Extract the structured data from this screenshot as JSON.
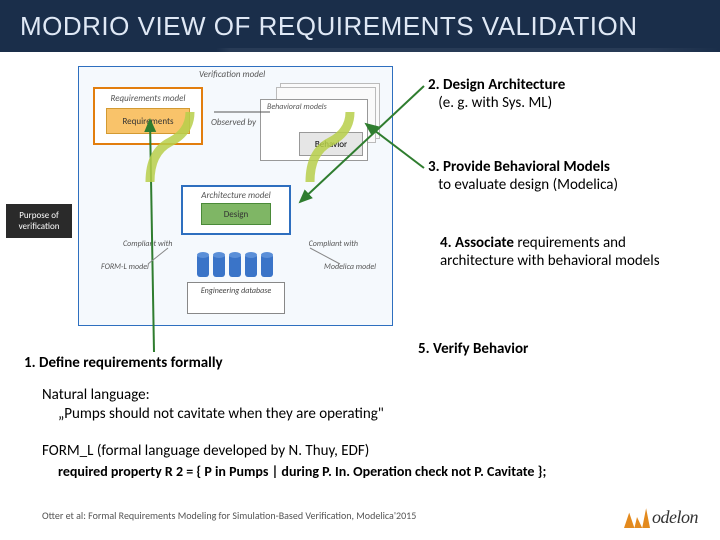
{
  "title": "MODRIO VIEW OF REQUIREMENTS VALIDATION",
  "diagram": {
    "verif_label": "Verification model",
    "req_box_label": "Requirements model",
    "req_inner": "Requirements",
    "observed_by": "Observed by",
    "beh_box_label": "Behavioral models",
    "beh_inner": "Behavior",
    "arch_box_label": "Architecture model",
    "arch_inner": "Design",
    "compliant_left": "Compliant with",
    "compliant_right": "Compliant with",
    "forml_label": "FORM-L model",
    "modelica_label": "Modelica model",
    "db_label": "Engineering database"
  },
  "purpose_badge": "Purpose of verification",
  "callouts": {
    "c1": "1. Define requirements formally",
    "c2_b": "2. Design Architecture",
    "c2_s": "(e. g. with Sys. ML)",
    "c3_b": "3. Provide Behavioral Models",
    "c3_s": "to evaluate design (Modelica)",
    "c4_b": "4. Associate",
    "c4_s": " requirements and architecture with behavioral models",
    "c5": "5. Verify Behavior"
  },
  "body": {
    "nl_heading": "Natural language:",
    "nl_quote": "„Pumps should not cavitate when they are  operating\"",
    "forml_heading": "FORM_L (formal language developed by N. Thuy, EDF)",
    "forml_code": "required property R 2 = { P in Pumps | during P. In. Operation check not P. Cavitate };"
  },
  "citation": "Otter et al: Formal Requirements Modeling for Simulation-Based Verification, Modelica'2015",
  "logo_text": "odelon"
}
